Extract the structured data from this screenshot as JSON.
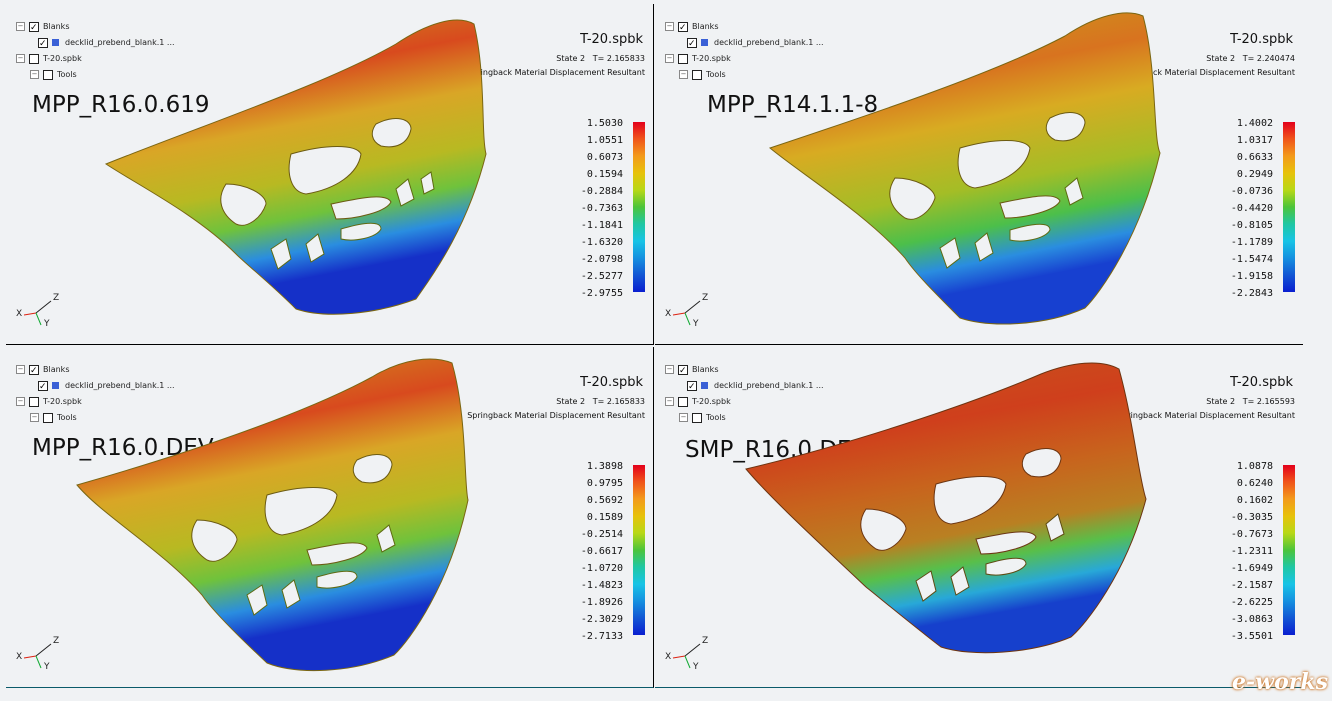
{
  "panels": [
    {
      "tree": {
        "blanks": "Blanks",
        "blank_item": "decklid_prebend_blank.1 ...",
        "file_node": "T-20.spbk",
        "tools": "Tools"
      },
      "file": "T-20.spbk",
      "state": "State 2   T= 2.165833",
      "subtitle": "Springback Material Displacement Resultant",
      "version": "MPP_R16.0.619",
      "legend": [
        "1.5030",
        "1.0551",
        "0.6073",
        "0.1594",
        "-0.2884",
        "-0.7363",
        "-1.1841",
        "-1.6320",
        "-2.0798",
        "-2.5277",
        "-2.9755"
      ],
      "axes": {
        "x": "X",
        "y": "Y",
        "z": "Z"
      }
    },
    {
      "tree": {
        "blanks": "Blanks",
        "blank_item": "decklid_prebend_blank.1 ...",
        "file_node": "T-20.spbk",
        "tools": "Tools"
      },
      "file": "T-20.spbk",
      "state": "State 2   T= 2.240474",
      "subtitle": "Springback Material Displacement Resultant",
      "version": "MPP_R14.1.1-8",
      "legend": [
        "1.4002",
        "1.0317",
        "0.6633",
        "0.2949",
        "-0.0736",
        "-0.4420",
        "-0.8105",
        "-1.1789",
        "-1.5474",
        "-1.9158",
        "-2.2843"
      ],
      "axes": {
        "x": "X",
        "y": "Y",
        "z": "Z"
      }
    },
    {
      "tree": {
        "blanks": "Blanks",
        "blank_item": "decklid_prebend_blank.1 ...",
        "file_node": "T-20.spbk",
        "tools": "Tools"
      },
      "file": "T-20.spbk",
      "state": "State 2   T= 2.165833",
      "subtitle": "Springback Material Displacement Resultant",
      "version": "MPP_R16.0.DEV",
      "legend": [
        "1.3898",
        "0.9795",
        "0.5692",
        "0.1589",
        "-0.2514",
        "-0.6617",
        "-1.0720",
        "-1.4823",
        "-1.8926",
        "-2.3029",
        "-2.7133"
      ],
      "axes": {
        "x": "X",
        "y": "Y",
        "z": "Z"
      }
    },
    {
      "tree": {
        "blanks": "Blanks",
        "blank_item": "decklid_prebend_blank.1 ...",
        "file_node": "T-20.spbk",
        "tools": "Tools"
      },
      "file": "T-20.spbk",
      "state": "State 2   T= 2.165593",
      "subtitle": "Springback Material Displacement Resultant",
      "version": "SMP_R16.0.DEV",
      "legend": [
        "1.0878",
        "0.6240",
        "0.1602",
        "-0.3035",
        "-0.7673",
        "-1.2311",
        "-1.6949",
        "-2.1587",
        "-2.6225",
        "-3.0863",
        "-3.5501"
      ],
      "axes": {
        "x": "X",
        "y": "Y",
        "z": "Z"
      }
    }
  ],
  "colors": {
    "legend_scale": [
      "#e3001b",
      "#f0541a",
      "#f39a1b",
      "#e7c20b",
      "#b8d816",
      "#4cc43a",
      "#1fc7a3",
      "#18c4e6",
      "#1590e0",
      "#1256d4",
      "#0a1ed0"
    ]
  },
  "watermark": "e-works"
}
